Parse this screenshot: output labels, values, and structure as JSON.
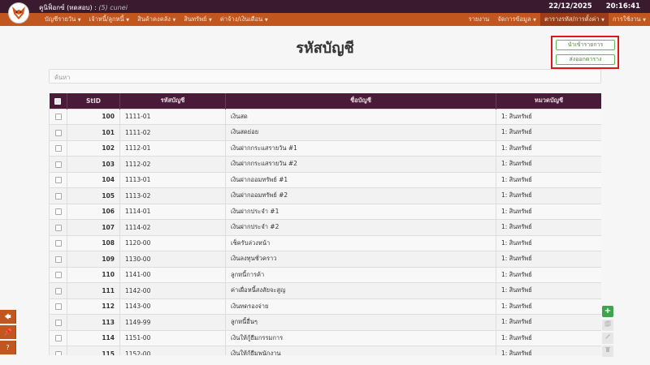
{
  "app": {
    "title": "คูนิฟ็อกซ์ (ทดสอบ)",
    "separator": ":",
    "user": "(5) cunei",
    "date": "22/12/2025",
    "time": "20:16:41"
  },
  "nav": {
    "left": [
      {
        "label": "บัญชีรายวัน"
      },
      {
        "label": "เจ้าหนี้/ลูกหนี้"
      },
      {
        "label": "สินค้าคงคลัง"
      },
      {
        "label": "สินทรัพย์"
      },
      {
        "label": "ค่าจ้าง/เงินเดือน"
      }
    ],
    "right": [
      {
        "label": "รายงาน",
        "dropdown": false
      },
      {
        "label": "จัดการข้อมูล",
        "dropdown": true
      },
      {
        "label": "ตารางรหัส/การตั้งค่า",
        "dropdown": true,
        "active": true
      },
      {
        "label": "การใช้งาน",
        "dropdown": true
      }
    ]
  },
  "page": {
    "title": "รหัสบัญชี",
    "search_placeholder": "ค้นหา"
  },
  "actions": {
    "import_label": "นำเข้ารายการ",
    "export_label": "ส่งออกตาราง"
  },
  "table": {
    "headers": {
      "stid": "StID",
      "code": "รหัสบัญชี",
      "name": "ชื่อบัญชี",
      "category": "หมวดบัญชี"
    },
    "rows": [
      {
        "stid": "100",
        "code": "1111-01",
        "name": "เงินสด",
        "category": "1: สินทรัพย์"
      },
      {
        "stid": "101",
        "code": "1111-02",
        "name": "เงินสดย่อย",
        "category": "1: สินทรัพย์"
      },
      {
        "stid": "102",
        "code": "1112-01",
        "name": "เงินฝากกระแสรายวัน #1",
        "category": "1: สินทรัพย์"
      },
      {
        "stid": "103",
        "code": "1112-02",
        "name": "เงินฝากกระแสรายวัน #2",
        "category": "1: สินทรัพย์"
      },
      {
        "stid": "104",
        "code": "1113-01",
        "name": "เงินฝากออมทรัพย์ #1",
        "category": "1: สินทรัพย์"
      },
      {
        "stid": "105",
        "code": "1113-02",
        "name": "เงินฝากออมทรัพย์ #2",
        "category": "1: สินทรัพย์"
      },
      {
        "stid": "106",
        "code": "1114-01",
        "name": "เงินฝากประจำ #1",
        "category": "1: สินทรัพย์"
      },
      {
        "stid": "107",
        "code": "1114-02",
        "name": "เงินฝากประจำ #2",
        "category": "1: สินทรัพย์"
      },
      {
        "stid": "108",
        "code": "1120-00",
        "name": "เช็ครับล่วงหน้า",
        "category": "1: สินทรัพย์"
      },
      {
        "stid": "109",
        "code": "1130-00",
        "name": "เงินลงทุนชั่วคราว",
        "category": "1: สินทรัพย์"
      },
      {
        "stid": "110",
        "code": "1141-00",
        "name": "ลูกหนี้การค้า",
        "category": "1: สินทรัพย์"
      },
      {
        "stid": "111",
        "code": "1142-00",
        "name": "ค่าเผื่อหนี้สงสัยจะสูญ",
        "category": "1: สินทรัพย์"
      },
      {
        "stid": "112",
        "code": "1143-00",
        "name": "เงินทดรองจ่าย",
        "category": "1: สินทรัพย์"
      },
      {
        "stid": "113",
        "code": "1149-99",
        "name": "ลูกหนี้อื่นๆ",
        "category": "1: สินทรัพย์"
      },
      {
        "stid": "114",
        "code": "1151-00",
        "name": "เงินให้กู้ยืมกรรมการ",
        "category": "1: สินทรัพย์"
      },
      {
        "stid": "115",
        "code": "1152-00",
        "name": "เงินให้กู้ยืมพนักงาน",
        "category": "1: สินทรัพย์"
      }
    ]
  },
  "left_buttons": {
    "b1": "🡄",
    "b2": "📌",
    "b3": "?"
  },
  "right_buttons": {
    "add": "+"
  },
  "colors": {
    "topbar": "#3a1a2f",
    "navbar": "#c2561f",
    "table_header": "#4a1a39",
    "highlight": "#e0161d",
    "add": "#3fa34d"
  }
}
